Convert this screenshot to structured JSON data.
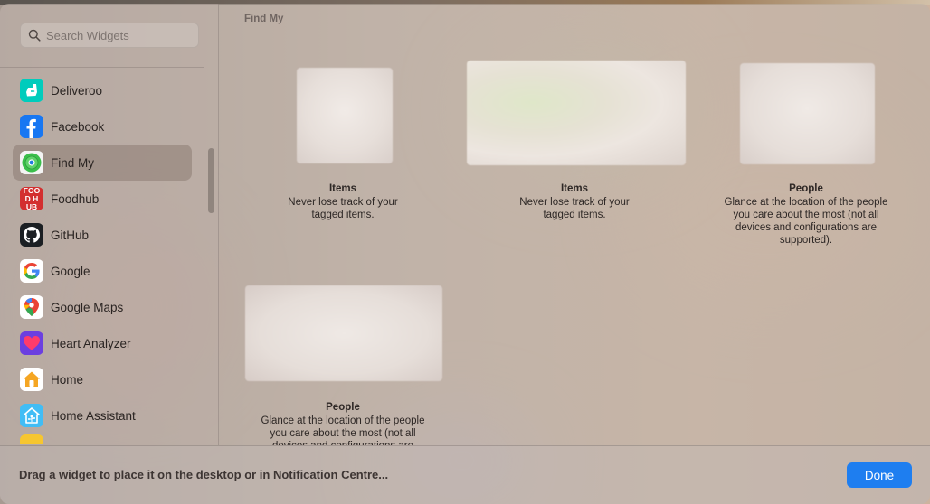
{
  "search": {
    "placeholder": "Search Widgets"
  },
  "sidebar": {
    "items": [
      {
        "label": "Deliveroo",
        "icon": "deliveroo-icon",
        "selected": false
      },
      {
        "label": "Facebook",
        "icon": "facebook-icon",
        "selected": false
      },
      {
        "label": "Find My",
        "icon": "find-my-icon",
        "selected": true
      },
      {
        "label": "Foodhub",
        "icon": "foodhub-icon",
        "icon_text": "FOOD HUB",
        "selected": false
      },
      {
        "label": "GitHub",
        "icon": "github-icon",
        "selected": false
      },
      {
        "label": "Google",
        "icon": "google-icon",
        "selected": false
      },
      {
        "label": "Google Maps",
        "icon": "google-maps-icon",
        "selected": false
      },
      {
        "label": "Heart Analyzer",
        "icon": "heart-analyzer-icon",
        "selected": false
      },
      {
        "label": "Home",
        "icon": "home-icon",
        "selected": false
      },
      {
        "label": "Home Assistant",
        "icon": "home-assistant-icon",
        "selected": false
      }
    ]
  },
  "main": {
    "section_title": "Find My",
    "widgets": [
      {
        "name": "Items",
        "description": "Never lose track of your tagged items."
      },
      {
        "name": "Items",
        "description": "Never lose track of your tagged items."
      },
      {
        "name": "People",
        "description": "Glance at the location of the people you care about the most (not all devices and configurations are supported)."
      },
      {
        "name": "People",
        "description": "Glance at the location of the people you care about the most (not all devices and configurations are supported)."
      }
    ]
  },
  "footer": {
    "hint": "Drag a widget to place it on the desktop or in Notification Centre...",
    "done_label": "Done"
  },
  "colors": {
    "accent": "#1e7ef0",
    "deliveroo": "#00ccbc",
    "facebook": "#1877f2",
    "foodhub": "#d32f2f",
    "heart_analyzer": "#6b3fe0"
  }
}
